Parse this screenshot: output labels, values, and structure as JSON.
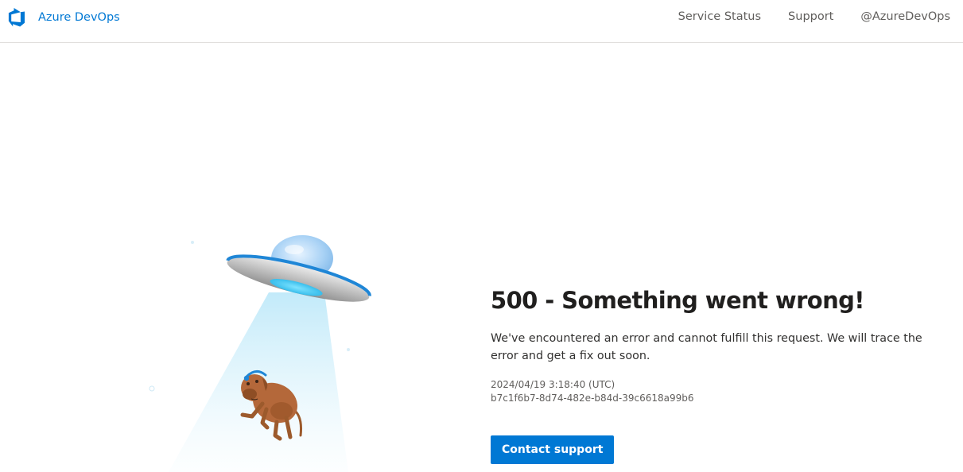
{
  "header": {
    "brand_name": "Azure DevOps",
    "brand_icon": "azure-devops-logo-icon",
    "nav": [
      {
        "label": "Service Status"
      },
      {
        "label": "Support"
      },
      {
        "label": "@AzureDevOps"
      }
    ]
  },
  "error": {
    "title": "500 - Something went wrong!",
    "description": "We've encountered an error and cannot fulfill this request. We will trace the error and get a fix out soon.",
    "timestamp": "2024/04/19 3:18:40 (UTC)",
    "activity_id": "b7c1f6b7-8d74-482e-b84d-39c6618a99b6",
    "button_label": "Contact support"
  },
  "colors": {
    "accent": "#0078d4",
    "text": "#201f1e",
    "muted": "#605e5c"
  },
  "illustration": {
    "subject": "ufo-abducting-dog-illustration"
  }
}
